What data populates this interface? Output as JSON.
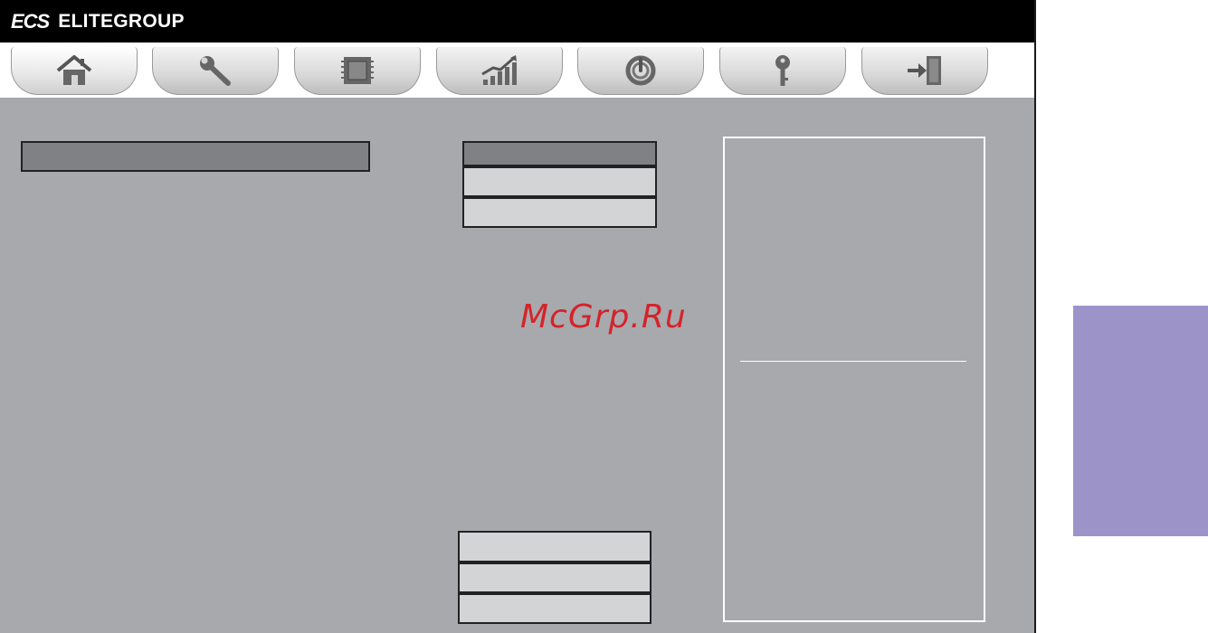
{
  "brand": {
    "mark": "ECS",
    "name": "ELITEGROUP"
  },
  "tabs": [
    {
      "icon": "home-icon",
      "active": true
    },
    {
      "icon": "wrench-icon",
      "active": false
    },
    {
      "icon": "cpu-chip-icon",
      "active": false
    },
    {
      "icon": "performance-chart-icon",
      "active": false
    },
    {
      "icon": "power-icon",
      "active": false
    },
    {
      "icon": "key-icon",
      "active": false
    },
    {
      "icon": "exit-icon",
      "active": false
    }
  ],
  "watermark": "McGrp.Ru",
  "colors": {
    "title_bar": "#000000",
    "panel": "#a8a9ad",
    "highlight": "#808185",
    "field": "#d3d4d6",
    "watermark": "#d4232a",
    "side_tab": "#9c94c9"
  }
}
